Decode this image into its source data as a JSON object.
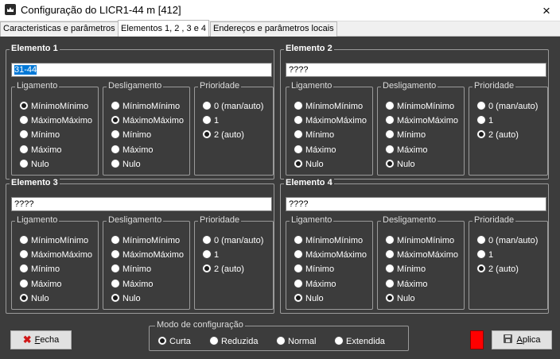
{
  "window": {
    "title": "Configuração do LICR1-44 m  [412]",
    "close_icon": "×"
  },
  "tabs": [
    {
      "label": "Caracteristicas e parâmetros",
      "active": false
    },
    {
      "label": "Elementos 1, 2 , 3 e 4",
      "active": true
    },
    {
      "label": "Endereços e parâmetros locais",
      "active": false
    }
  ],
  "group_titles": {
    "ligamento": "Ligamento",
    "desligamento": "Desligamento",
    "prioridade": "Prioridade"
  },
  "options": {
    "switch": [
      "MínimoMínimo",
      "MáximoMáximo",
      "Mínimo",
      "Máximo",
      "Nulo"
    ],
    "priority": [
      "0 (man/auto)",
      "1",
      "2 (auto)"
    ]
  },
  "elements": [
    {
      "title": "Elemento 1",
      "name": "31-44",
      "name_selected": true,
      "ligamento": 0,
      "desligamento": 1,
      "prioridade": 2
    },
    {
      "title": "Elemento 2",
      "name": "????",
      "name_selected": false,
      "ligamento": 4,
      "desligamento": 4,
      "prioridade": 2
    },
    {
      "title": "Elemento 3",
      "name": "????",
      "name_selected": false,
      "ligamento": 4,
      "desligamento": 4,
      "prioridade": 2
    },
    {
      "title": "Elemento 4",
      "name": "????",
      "name_selected": false,
      "ligamento": 4,
      "desligamento": 4,
      "prioridade": 2
    }
  ],
  "footer": {
    "close_button": {
      "accel": "F",
      "rest": "echa",
      "icon": "close-icon"
    },
    "apply_button": {
      "accel": "A",
      "rest": "plica",
      "icon": "save-icon"
    },
    "mode": {
      "title": "Modo de configuração",
      "options": [
        "Curta",
        "Reduzida",
        "Normal",
        "Extendida"
      ],
      "selected": 0
    },
    "indicator_color": "#ff0000"
  }
}
